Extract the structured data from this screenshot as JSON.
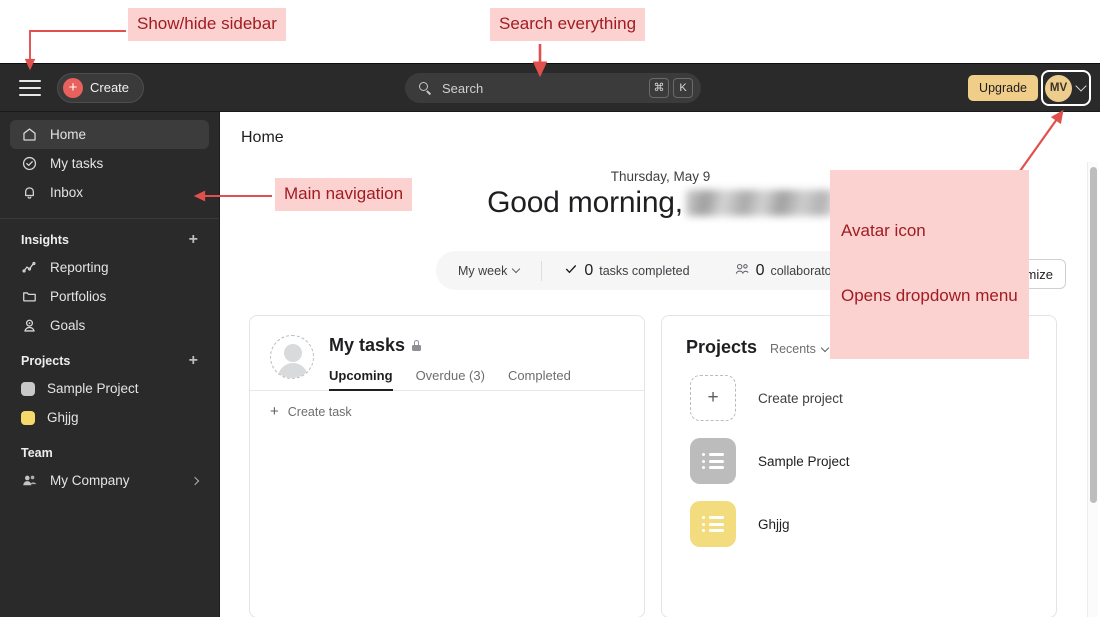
{
  "annotations": [
    {
      "id": "show-hide-sidebar",
      "text": "Show/hide sidebar"
    },
    {
      "id": "search-everything",
      "text": "Search everything"
    },
    {
      "id": "main-navigation",
      "text": "Main navigation"
    },
    {
      "id": "avatar-dropdown",
      "line1": "Avatar icon",
      "line2": "Opens dropdown menu"
    }
  ],
  "topbar": {
    "create_label": "Create",
    "search_placeholder": "Search",
    "shortcut_cmd": "⌘",
    "shortcut_key": "K",
    "upgrade_label": "Upgrade",
    "avatar_initials": "MV"
  },
  "sidebar": {
    "primary": [
      {
        "label": "Home",
        "icon": "home-icon",
        "active": true
      },
      {
        "label": "My tasks",
        "icon": "check-circle-icon",
        "active": false
      },
      {
        "label": "Inbox",
        "icon": "bell-icon",
        "active": false
      }
    ],
    "insights": {
      "title": "Insights",
      "add_label": "+",
      "items": [
        {
          "label": "Reporting",
          "icon": "chart-line-icon"
        },
        {
          "label": "Portfolios",
          "icon": "folder-icon"
        },
        {
          "label": "Goals",
          "icon": "goal-icon"
        }
      ]
    },
    "projects": {
      "title": "Projects",
      "add_label": "+",
      "items": [
        {
          "label": "Sample Project",
          "color": "#c8c8c8"
        },
        {
          "label": "Ghjjg",
          "color": "#f5d96b"
        }
      ]
    },
    "team": {
      "title": "Team",
      "items": [
        {
          "label": "My Company",
          "icon": "people-icon"
        }
      ]
    }
  },
  "main": {
    "page_title": "Home",
    "greeting": {
      "date": "Thursday, May 9",
      "text": "Good morning,",
      "name": "(blurred)"
    },
    "statbar": {
      "range_label": "My week",
      "tasks_count": "0",
      "tasks_label": "tasks completed",
      "collaborators_count": "0",
      "collaborators_label": "collaborators"
    },
    "customize_label": "Customize",
    "my_tasks_card": {
      "title": "My tasks",
      "privacy_icon": "lock-icon",
      "tabs": [
        {
          "label": "Upcoming",
          "active": true
        },
        {
          "label": "Overdue (3)",
          "active": false
        },
        {
          "label": "Completed",
          "active": false
        }
      ],
      "create_task_label": "Create task"
    },
    "projects_card": {
      "title": "Projects",
      "filter_label": "Recents",
      "rows": [
        {
          "label": "Create project",
          "type": "new",
          "color": ""
        },
        {
          "label": "Sample Project",
          "type": "project",
          "color": "#bcbcbc"
        },
        {
          "label": "Ghjjg",
          "type": "project",
          "color": "#f2dc7e"
        }
      ]
    }
  },
  "colors": {
    "annotation_bg": "#fbd2d0",
    "annotation_text": "#a01c22",
    "arrow": "#e2504d",
    "topbar_bg": "#2a2a2a",
    "sidebar_bg": "#2a2a2a",
    "accent_create": "#e8615c",
    "upgrade_bg": "#f0cd88",
    "avatar_bg": "#eccd8e"
  }
}
